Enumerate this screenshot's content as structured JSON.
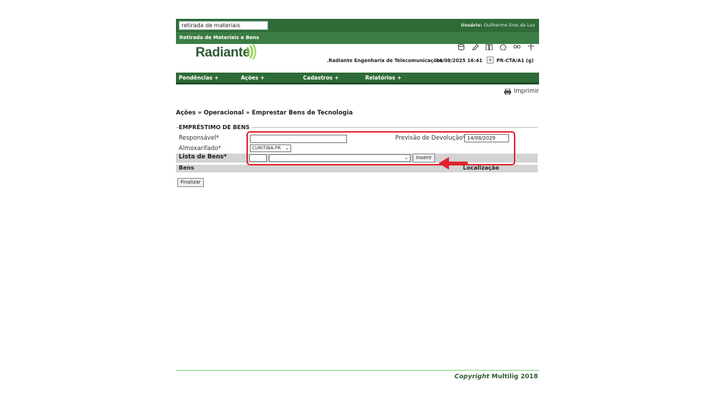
{
  "topbar": {
    "search_value": "retirada de materiais",
    "user_label": "Usuário:",
    "user_name": "Guilherme Eros da Luz"
  },
  "subbar": {
    "title": "Retirada de Materiais e Bens"
  },
  "header": {
    "logo_text": "Radiante",
    "company": ".Radiante Engenharia de Telecomunicações",
    "datetime": "14/08/2025 16:41",
    "unit_button": "+",
    "unit": "PR-CTA/A1 (g)",
    "icons": [
      "database-icon",
      "pencil-icon",
      "book-icon",
      "info-icon",
      "people-icon",
      "scale-icon"
    ]
  },
  "nav": {
    "items": [
      {
        "label": "Pendências +"
      },
      {
        "label": "Ações +"
      },
      {
        "label": "Cadastros +"
      },
      {
        "label": "Relatórios +"
      }
    ]
  },
  "print_label": "Imprimir",
  "breadcrumb": "Ações » Operacional » Emprestar Bens de Tecnologia",
  "form": {
    "section_title": "EMPRÉSTIMO DE BENS",
    "responsavel_label": "Responsável*",
    "responsavel_value": "",
    "previsao_label": "Previsão de Devolução*",
    "previsao_value": "14/08/2029",
    "almoxarifado_label": "Almoxarifado*",
    "almoxarifado_value": "CURITIBA-PR",
    "lista_label": "Lista de Bens*",
    "code_value": "",
    "bem_select_value": "",
    "inserir_label": "Inserir",
    "col_bens": "Bens",
    "col_localizacao": "Localização",
    "finalizar_label": "Finalizar"
  },
  "footer": {
    "copyright_word": "Copyright",
    "copyright_rest": " Multilig 2018"
  },
  "colors": {
    "brand_green": "#2e6b36",
    "annotation_red": "#e0212b"
  }
}
